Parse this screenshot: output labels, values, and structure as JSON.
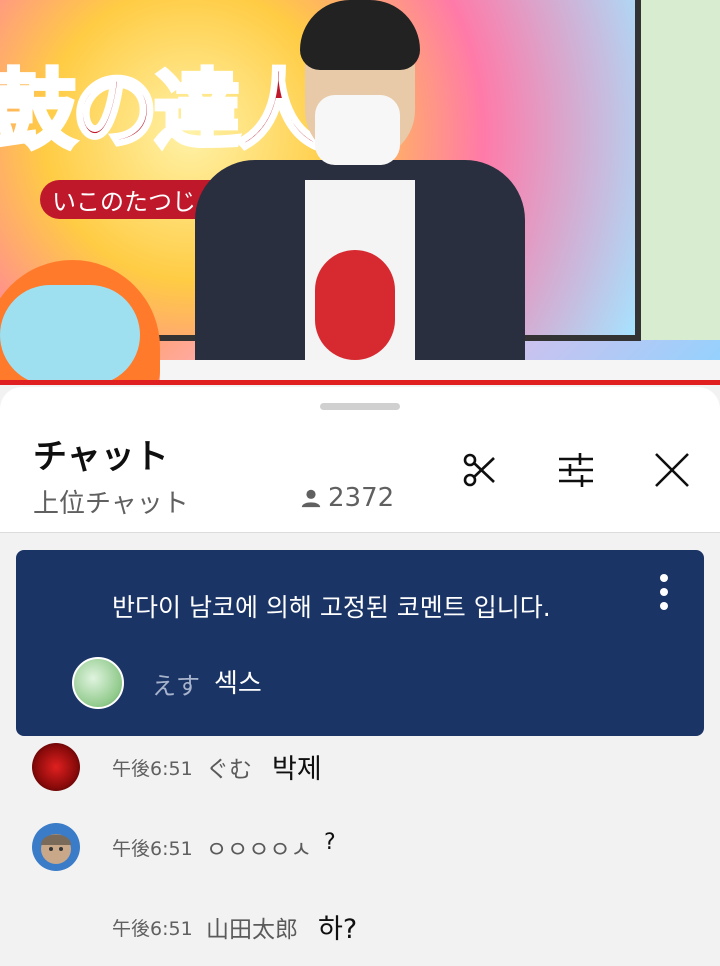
{
  "video": {
    "logo_text": "鼓の達人",
    "logo_sub": "いこのたつじん"
  },
  "chat": {
    "title": "チャット",
    "mode": "上位チャット",
    "viewer_count": "2372",
    "icons": [
      "scissors-icon",
      "sliders-icon",
      "close-icon",
      "person-icon",
      "more-vert-icon"
    ]
  },
  "pinned": {
    "banner": "반다이 남코에 의해 고정된 코멘트 입니다.",
    "author": "えす",
    "message": "섹스"
  },
  "messages": [
    {
      "time": "午後6:51",
      "author": "ぐむ",
      "text": "박제",
      "avatar_color": "#c01818"
    },
    {
      "time": "午後6:51",
      "author": "ㅇㅇㅇㅇㅅ",
      "text": "?",
      "avatar_color": "#3a7cc7"
    },
    {
      "time": "午後6:51",
      "author": "山田太郎",
      "text": "하?",
      "avatar_color": ""
    }
  ]
}
